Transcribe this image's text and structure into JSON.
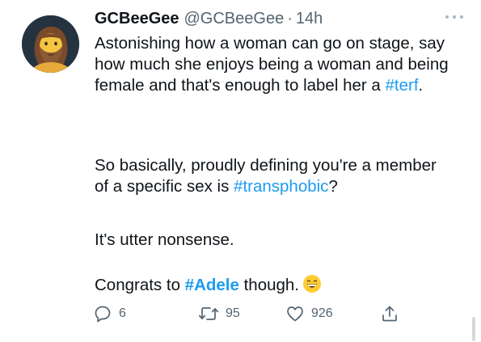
{
  "tweet": {
    "author_name": "GCBeeGee",
    "author_handle": "@GCBeeGee",
    "separator": "·",
    "time": "14h",
    "paragraphs": [
      {
        "before": "Astonishing how a woman can go on stage, say how much she enjoys being a woman and being female and that's enough to label her a ",
        "link": "#terf",
        "after": "."
      },
      {
        "before": "So basically, proudly defining you're a member of a specific sex is ",
        "link": "#transphobic",
        "after": "?"
      },
      {
        "text": "It's utter nonsense."
      },
      {
        "before": "Congrats to ",
        "link": "#Adele",
        "after": " though."
      }
    ],
    "emoji_icon": "grinning-face-with-smiling-eyes-icon"
  },
  "actions": {
    "reply_count": "6",
    "retweet_count": "95",
    "like_count": "926"
  },
  "colors": {
    "link": "#1d9bf0",
    "secondary_text": "#536471",
    "primary_text": "#0f1419",
    "avatar_background": "#253341"
  }
}
